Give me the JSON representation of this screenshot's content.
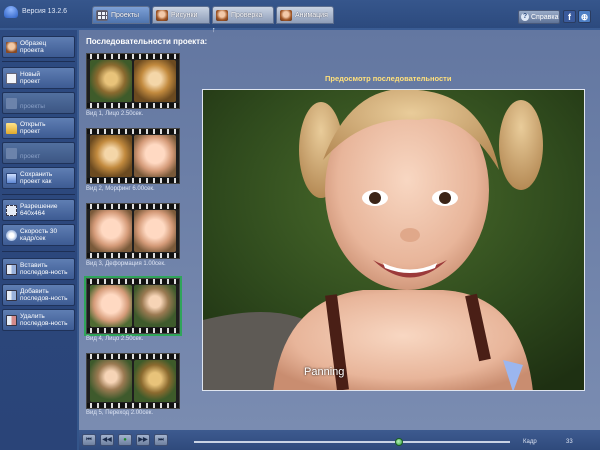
{
  "app": {
    "version": "Версия 13.2.6"
  },
  "tabs": [
    {
      "label": "Проекты",
      "active": true,
      "icon": "grid-icon"
    },
    {
      "label": "Рисунки",
      "active": false,
      "icon": "photo-icon"
    },
    {
      "label": "Проверка",
      "active": false,
      "icon": "photo-icon"
    },
    {
      "label": "Анимация",
      "active": false,
      "icon": "photo-icon"
    }
  ],
  "header_buttons": {
    "help_label": "Справка",
    "facebook": "f",
    "globe": "⊕"
  },
  "sidebar": {
    "items": [
      {
        "label": "Образец\nпроекта",
        "enabled": true,
        "icon": "sample-project-icon"
      },
      {
        "label": "Новый\nпроект",
        "enabled": true,
        "icon": "new-project-icon"
      },
      {
        "label": "\nпроекты",
        "enabled": false,
        "icon": "projects-icon"
      },
      {
        "label": "Открыть\nпроект",
        "enabled": true,
        "icon": "open-folder-icon"
      },
      {
        "label": "\nпроект",
        "enabled": false,
        "icon": "save-icon"
      },
      {
        "label": "Сохранить\nпроект как",
        "enabled": true,
        "icon": "save-as-icon"
      },
      {
        "label": "Разрешение\n640x464",
        "enabled": true,
        "icon": "resolution-icon"
      },
      {
        "label": "Скорость 30\nкадр/сек",
        "enabled": true,
        "icon": "speed-icon"
      },
      {
        "label": "Вставить\nпоследов-ность",
        "enabled": true,
        "icon": "insert-sequence-icon"
      },
      {
        "label": "Добавить\nпоследов-ность",
        "enabled": true,
        "icon": "add-sequence-icon"
      },
      {
        "label": "Удалить\nпоследов-ность",
        "enabled": true,
        "icon": "delete-sequence-icon"
      }
    ]
  },
  "sequences": {
    "header": "Последовательности проекта:",
    "items": [
      {
        "caption": "Вид 1,  Лицо 2.50сек."
      },
      {
        "caption": "Вид 2,  Морфинг 6.00сек."
      },
      {
        "caption": "Вид 3,  Деформация 1.00сек."
      },
      {
        "caption": "Вид 4,  Лицо 2.50сек."
      },
      {
        "caption": "Вид 5,  Переход 2.00сек."
      }
    ],
    "selected_index": 3
  },
  "preview": {
    "title": "Предосмотр последовательности",
    "overlay_text": "Panning"
  },
  "playback": {
    "buttons": [
      "⏮",
      "◀◀",
      "●",
      "▶▶",
      "⏭"
    ],
    "progress": 0.65,
    "frames_label": "Кадр",
    "frames_count": "33"
  },
  "colors": {
    "accent": "#ffe07a",
    "selected": "#2fa55a"
  }
}
